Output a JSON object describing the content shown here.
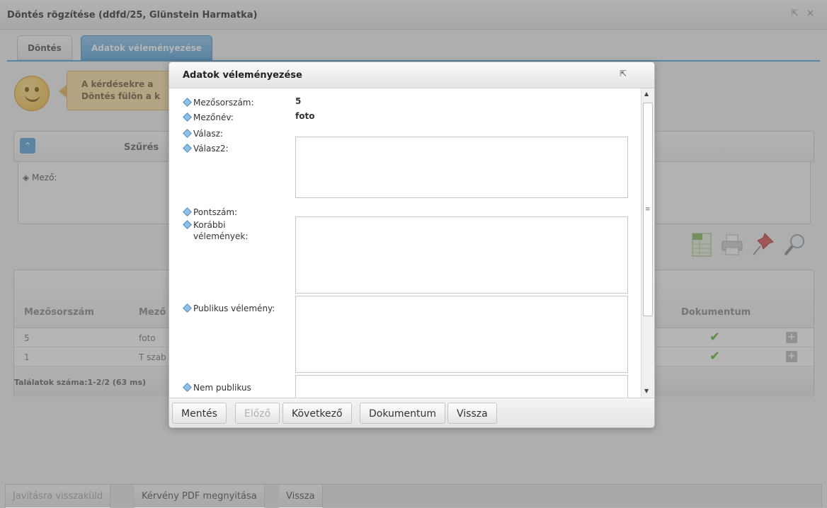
{
  "window": {
    "title": "Döntés rögzítése (ddfd/25, Glünstein Harmatka)",
    "popout_icon": "⇱",
    "close_icon": "✕"
  },
  "tabs": [
    {
      "label": "Döntés"
    },
    {
      "label": "Adatok véleményezése",
      "active": true
    }
  ],
  "hint": {
    "line1": "A kérdésekre a",
    "line2": "Döntés fülön a k"
  },
  "filter": {
    "collapse_icon": "chevron-up-icon",
    "title": "Szűrés",
    "field_label": "Mező:"
  },
  "toolbar": {
    "icons": [
      "excel-export-icon",
      "print-icon",
      "pin-icon",
      "search-icon"
    ]
  },
  "table": {
    "headers": {
      "col1": "Mezősorszám",
      "col2": "Mező",
      "col_doc": "Dokumentum"
    },
    "rows": [
      {
        "num": "5",
        "name": "foto",
        "has_doc": true
      },
      {
        "num": "1",
        "name": "T szab",
        "has_doc": true
      }
    ],
    "footer": "Találatok száma:1-2/2 (63 ms)"
  },
  "bottom_buttons": [
    {
      "label": "Javításra visszaküld",
      "disabled": true
    },
    {
      "label": "Kérvény PDF megnyitása"
    },
    {
      "label": "Vissza"
    }
  ],
  "modal": {
    "title": "Adatok véleményezése",
    "popout_icon": "⇱",
    "fields": {
      "mezosorszam": {
        "label": "Mezősorszám:",
        "value": "5"
      },
      "mezonev": {
        "label": "Mezőnév:",
        "value": "foto"
      },
      "valasz": {
        "label": "Válasz:"
      },
      "valasz2": {
        "label": "Válasz2:"
      },
      "pontszam": {
        "label": "Pontszám:"
      },
      "korabbi_line1": "Korábbi",
      "korabbi_line2": "vélemények:",
      "publikus": {
        "label": "Publikus vélemény:"
      },
      "nem_publikus": {
        "label": "Nem publikus"
      }
    },
    "buttons": {
      "save": "Mentés",
      "prev": "Előző",
      "next": "Következő",
      "document": "Dokumentum",
      "back": "Vissza"
    }
  },
  "colors": {
    "accent": "#5aa6dc",
    "check": "#5fba3a"
  }
}
